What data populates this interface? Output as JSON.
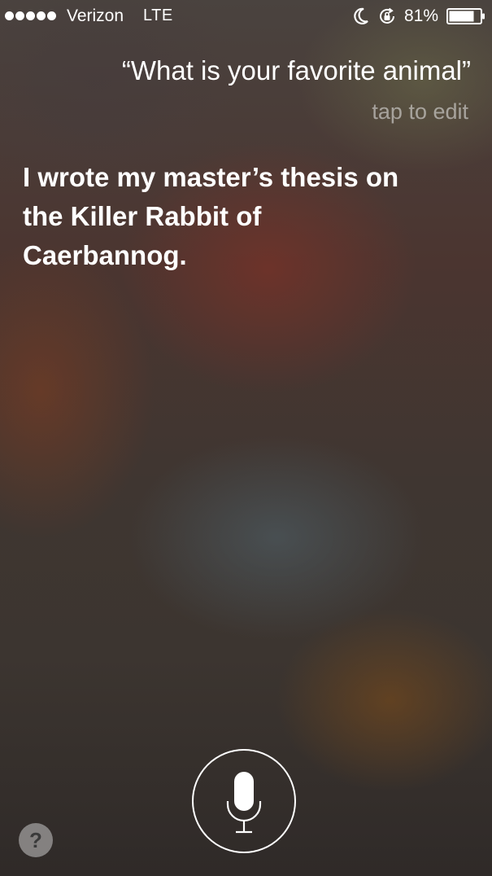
{
  "status_bar": {
    "signal_dots": 5,
    "carrier": "Verizon",
    "network": "LTE",
    "icons": [
      "moon-icon",
      "rotation-lock-icon",
      "battery-icon"
    ],
    "battery_percent": "81%",
    "battery_level": 0.81
  },
  "query": {
    "text": "“What is your favorite animal”",
    "edit_hint": "tap to edit"
  },
  "response": {
    "lines": [
      "I wrote my master’s thesis on",
      "the Killer Rabbit of",
      "Caerbannog."
    ]
  },
  "controls": {
    "mic_icon": "microphone-icon",
    "help_label": "?"
  }
}
